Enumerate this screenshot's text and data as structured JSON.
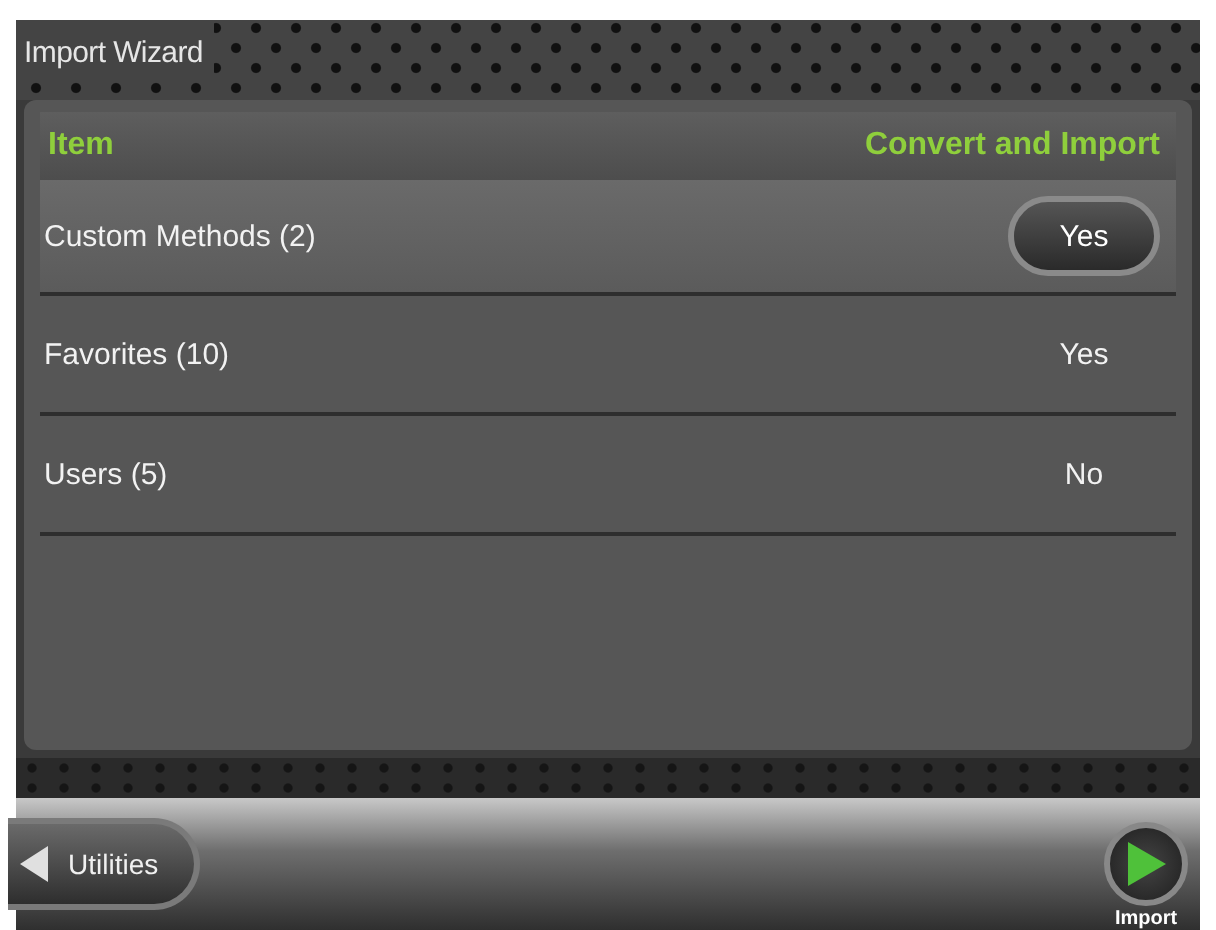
{
  "window": {
    "title": "Import Wizard"
  },
  "table": {
    "columns": [
      "Item",
      "Convert and Import"
    ],
    "rows": [
      {
        "item": "Custom Methods (2)",
        "value": "Yes",
        "selected": true
      },
      {
        "item": "Favorites (10)",
        "value": "Yes",
        "selected": false
      },
      {
        "item": "Users (5)",
        "value": "No",
        "selected": false
      }
    ]
  },
  "footer": {
    "back_button": "Utilities",
    "next_label": "Import"
  }
}
